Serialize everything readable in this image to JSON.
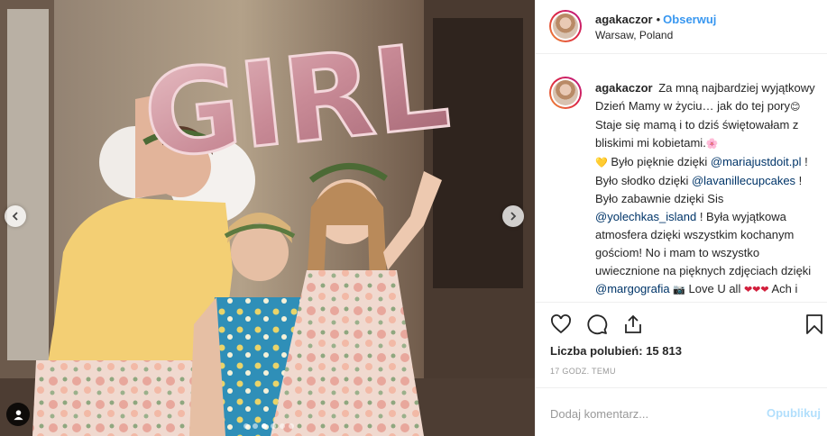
{
  "post": {
    "username": "agakaczor",
    "follow_label": "Obserwuj",
    "separator": "•",
    "location": "Warsaw, Poland",
    "balloon_text": "GIRL"
  },
  "caption": {
    "username": "agakaczor",
    "t1": "Za mną najbardziej wyjątkowy Dzień Mamy w życiu… jak do tej pory",
    "e1": "😊",
    "t2": " Staje się mamą i to dziś świętowałam z bliskimi mi kobietami.",
    "e2": "🌸",
    "e3": "💛",
    "t3": " Było pięknie dzięki ",
    "m1": "@mariajustdoit.pl",
    "t4": " ! Było słodko dzięki ",
    "m2": "@lavanillecupcakes",
    "t5": " ! Było zabawnie dzięki Sis ",
    "m3": "@yolechkas_island",
    "t6": " ! Była wyjątkowa atmosfera dzięki wszystkim kochanym gościom! No i mam to wszystko uwiecznione na pięknych zdjęciach dzięki ",
    "m4": "@margografia",
    "e4": "📷",
    "t7": " Love U all ",
    "e5": "❤❤❤",
    "t8": " Ach i pogoda była piękna! ",
    "e6": "🌦"
  },
  "likes": {
    "label": "Liczba polubień:",
    "count": "15 813"
  },
  "time_ago": "17 GODZ. TEMU",
  "comment": {
    "placeholder": "Dodaj komentarz...",
    "publish_label": "Opublikuj"
  },
  "icons": {
    "like": "heart-icon",
    "comment": "comment-bubble-icon",
    "share": "share-icon",
    "save": "bookmark-icon",
    "prev": "chevron-left-icon",
    "next": "chevron-right-icon",
    "tags": "user-tag-icon"
  },
  "carousel": {
    "slides": 6,
    "active_slide": 3
  },
  "colors": {
    "accent": "#3897f0",
    "mention": "#003569",
    "publish_disabled": "#b2dffc",
    "heart": "#ed4956",
    "balloon": "#d8a2ac"
  }
}
